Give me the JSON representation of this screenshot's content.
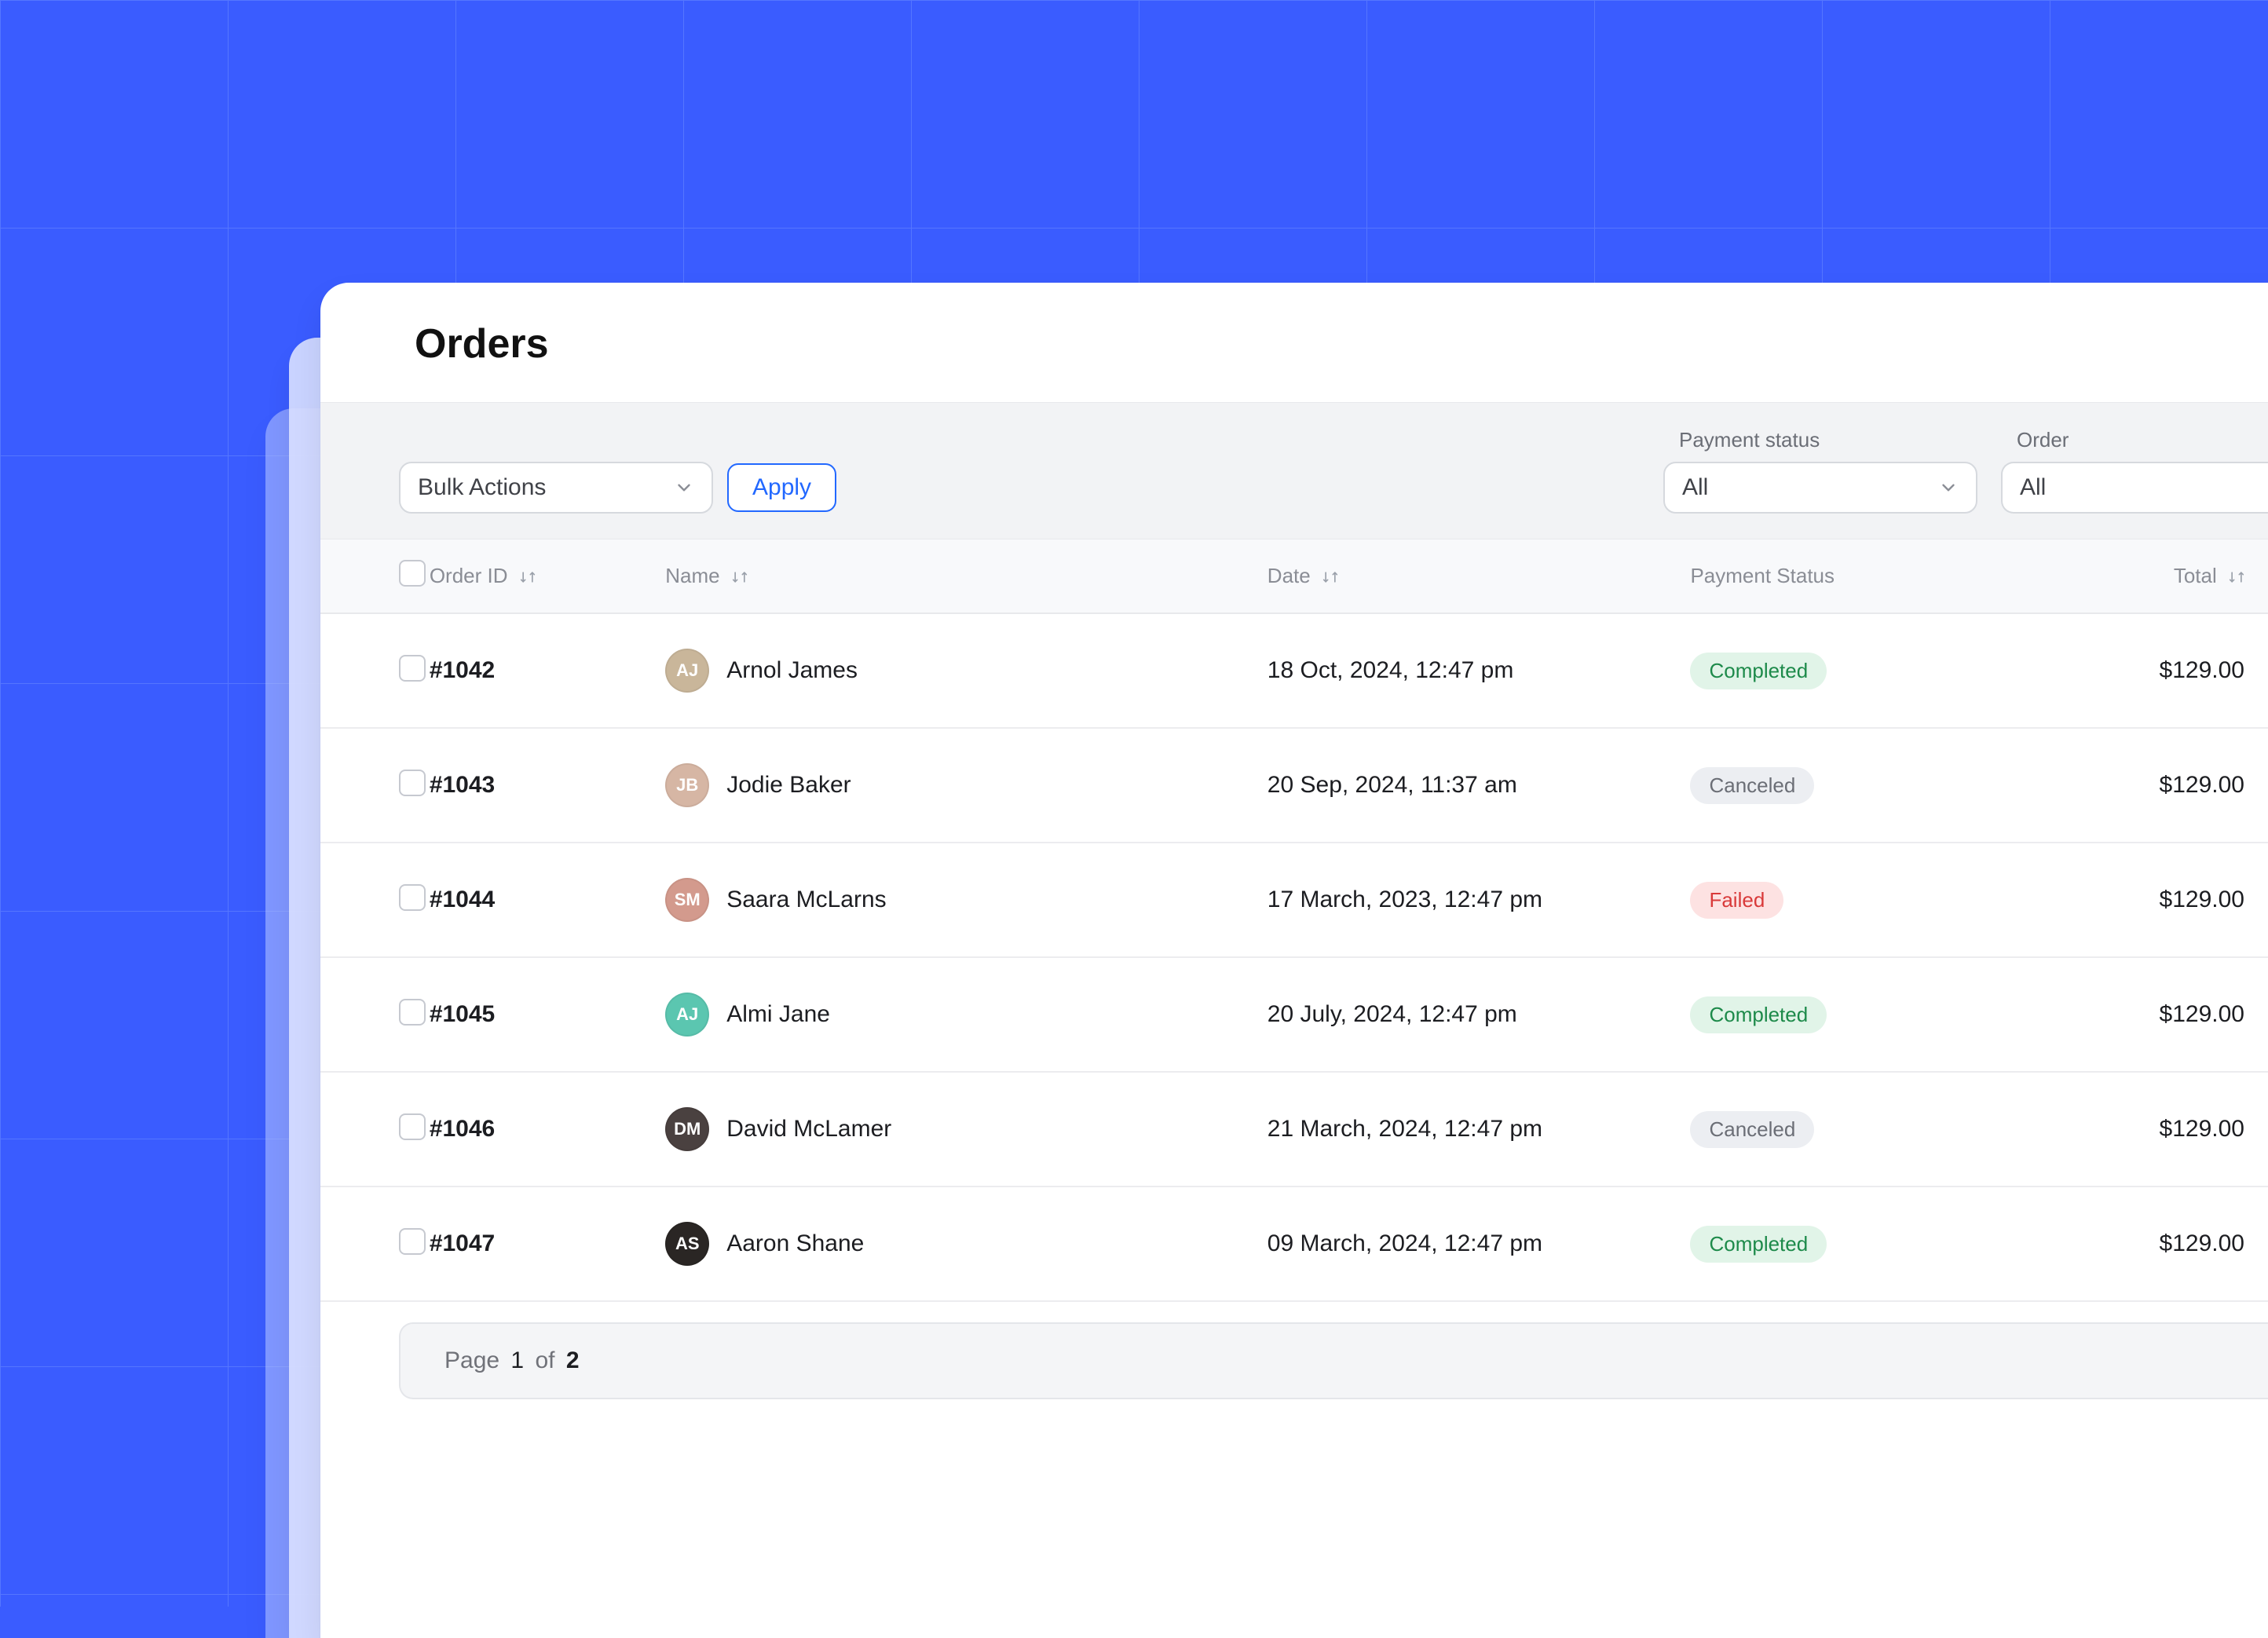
{
  "page": {
    "title": "Orders"
  },
  "toolbar": {
    "bulk_actions": {
      "selected": "Bulk Actions"
    },
    "apply_label": "Apply",
    "filters": {
      "payment_status": {
        "label": "Payment status",
        "selected": "All"
      },
      "order": {
        "label": "Order",
        "selected": "All"
      }
    }
  },
  "table": {
    "columns": {
      "order_id": "Order ID",
      "name": "Name",
      "date": "Date",
      "payment_status": "Payment Status",
      "total": "Total"
    },
    "rows": [
      {
        "id": "#1042",
        "name": "Arnol James",
        "date": "18 Oct, 2024, 12:47 pm",
        "status": "Completed",
        "status_kind": "completed",
        "total": "$129.00",
        "avatar_bg": "#c9b69a",
        "avatar_initials": "AJ"
      },
      {
        "id": "#1043",
        "name": "Jodie Baker",
        "date": "20 Sep, 2024, 11:37 am",
        "status": "Canceled",
        "status_kind": "canceled",
        "total": "$129.00",
        "avatar_bg": "#d6b6a4",
        "avatar_initials": "JB"
      },
      {
        "id": "#1044",
        "name": "Saara McLarns",
        "date": "17 March, 2023, 12:47 pm",
        "status": "Failed",
        "status_kind": "failed",
        "total": "$129.00",
        "avatar_bg": "#d39a8d",
        "avatar_initials": "SM"
      },
      {
        "id": "#1045",
        "name": "Almi Jane",
        "date": "20 July, 2024, 12:47 pm",
        "status": "Completed",
        "status_kind": "completed",
        "total": "$129.00",
        "avatar_bg": "#5bc6b0",
        "avatar_initials": "AJ"
      },
      {
        "id": "#1046",
        "name": "David McLamer",
        "date": "21 March, 2024, 12:47 pm",
        "status": "Canceled",
        "status_kind": "canceled",
        "total": "$129.00",
        "avatar_bg": "#4a4140",
        "avatar_initials": "DM"
      },
      {
        "id": "#1047",
        "name": "Aaron Shane",
        "date": "09 March, 2024, 12:47 pm",
        "status": "Completed",
        "status_kind": "completed",
        "total": "$129.00",
        "avatar_bg": "#2a2624",
        "avatar_initials": "AS"
      }
    ]
  },
  "pagination": {
    "prefix": "Page",
    "current": "1",
    "of": "of",
    "total": "2"
  }
}
